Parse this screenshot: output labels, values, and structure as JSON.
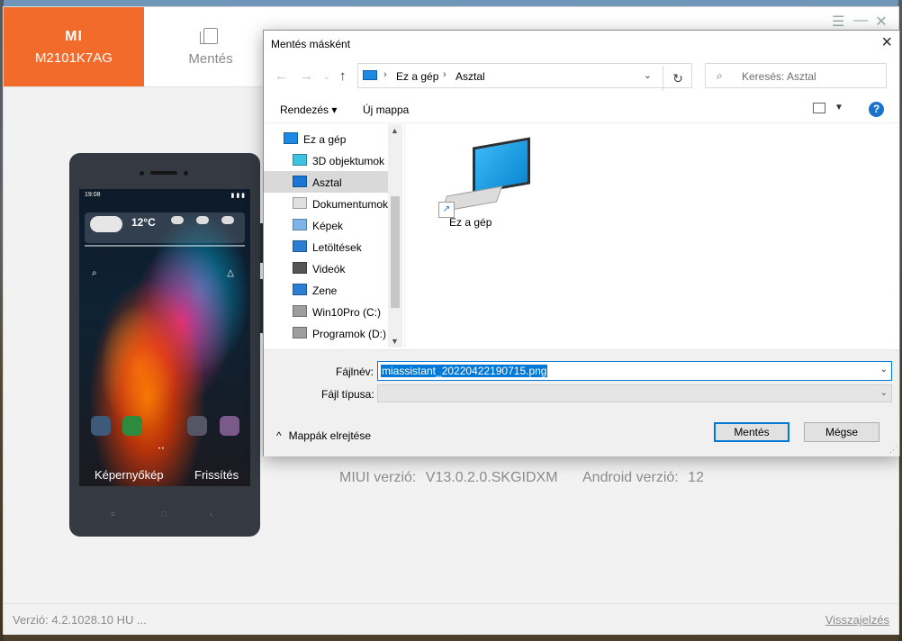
{
  "app": {
    "logo": "MI",
    "model": "M2101K7AG",
    "nav_backup": "Mentés",
    "miui_label": "MIUI verzió:",
    "miui_value": "V13.0.2.0.SKGIDXM",
    "android_label": "Android verzió:",
    "android_value": "12",
    "version_text": "Verzió:  4.2.1028.10 HU ...",
    "feedback": "Visszajelzés",
    "screenshot_label": "Képernyőkép",
    "refresh_label": "Frissítés",
    "phone_time": "19:08",
    "phone_temp": "12°C"
  },
  "dialog": {
    "title": "Mentés másként",
    "breadcrumb": [
      "Ez a gép",
      "Asztal"
    ],
    "search_placeholder": "Keresés: Asztal",
    "organize": "Rendezés",
    "new_folder": "Új mappa",
    "tree": [
      {
        "label": "Ez a gép",
        "icon": "pc-icon",
        "indent": 0,
        "selected": false
      },
      {
        "label": "3D objektumok",
        "icon": "cube-icon",
        "indent": 1,
        "selected": false
      },
      {
        "label": "Asztal",
        "icon": "desktop-icon",
        "indent": 1,
        "selected": true
      },
      {
        "label": "Dokumentumok",
        "icon": "document-icon",
        "indent": 1,
        "selected": false
      },
      {
        "label": "Képek",
        "icon": "pictures-icon",
        "indent": 1,
        "selected": false
      },
      {
        "label": "Letöltések",
        "icon": "download-icon",
        "indent": 1,
        "selected": false
      },
      {
        "label": "Videók",
        "icon": "video-icon",
        "indent": 1,
        "selected": false
      },
      {
        "label": "Zene",
        "icon": "music-icon",
        "indent": 1,
        "selected": false
      },
      {
        "label": "Win10Pro (C:)",
        "icon": "drive-icon",
        "indent": 1,
        "selected": false
      },
      {
        "label": "Programok (D:)",
        "icon": "drive-icon",
        "indent": 1,
        "selected": false
      }
    ],
    "file_item": "Ez a gép",
    "filename_label": "Fájlnév:",
    "filename_value": "miassistant_20220422190715.png",
    "filetype_label": "Fájl típusa:",
    "filetype_value": "",
    "hide_folders": "Mappák elrejtése",
    "save": "Mentés",
    "cancel": "Mégse"
  }
}
